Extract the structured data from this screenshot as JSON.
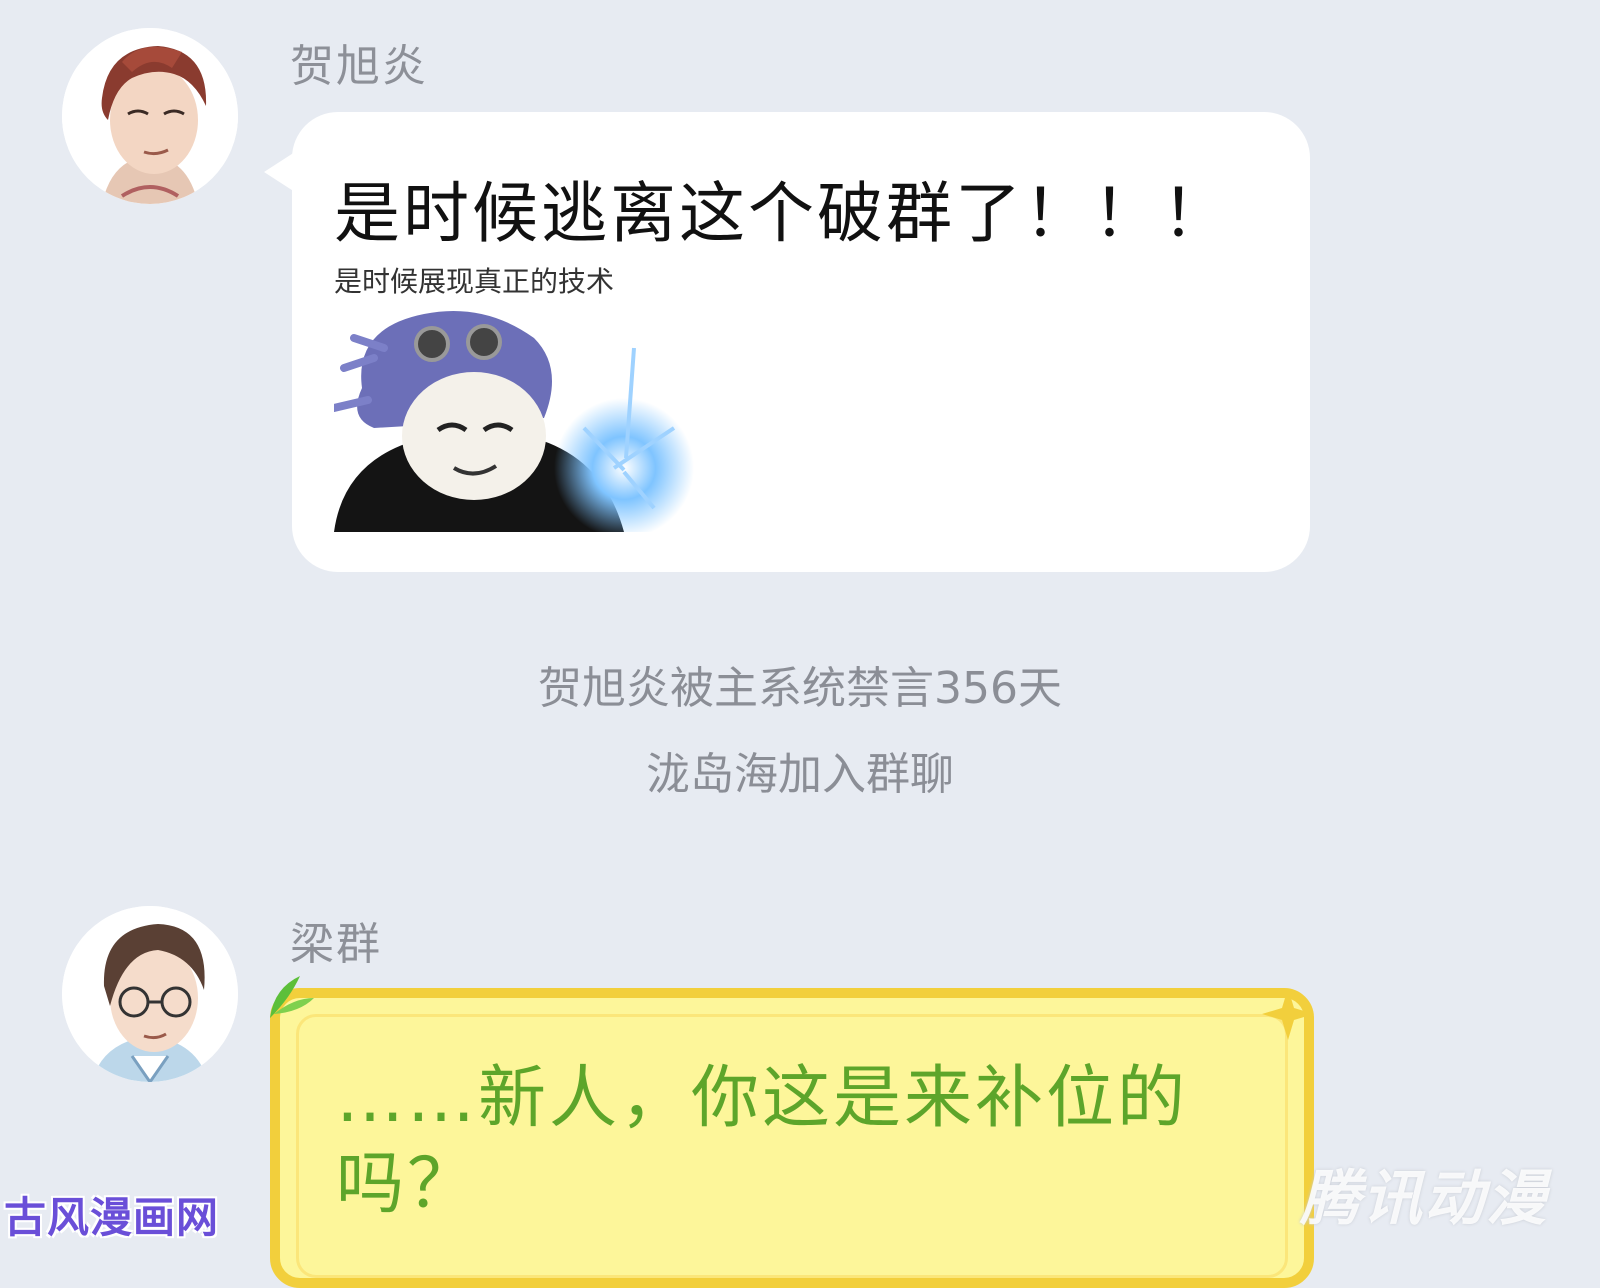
{
  "messages": [
    {
      "sender": "贺旭炎",
      "text": "是时候逃离这个破群了！！！",
      "sticker_caption": "是时候展现真正的技术"
    },
    {
      "sender": "梁群",
      "text": "……新人，你这是来补位的吗？"
    }
  ],
  "system_notices": [
    "贺旭炎被主系统禁言356天",
    "泷岛海加入群聊"
  ],
  "watermarks": {
    "left": "古风漫画网",
    "right": "腾讯动漫"
  },
  "colors": {
    "background": "#e7ebf2",
    "bubble_white": "#ffffff",
    "bubble_yellow": "#fdf69a",
    "yellow_border": "#f2cf3c",
    "green_text": "#5da52a",
    "gray_text": "#8b8e96"
  }
}
